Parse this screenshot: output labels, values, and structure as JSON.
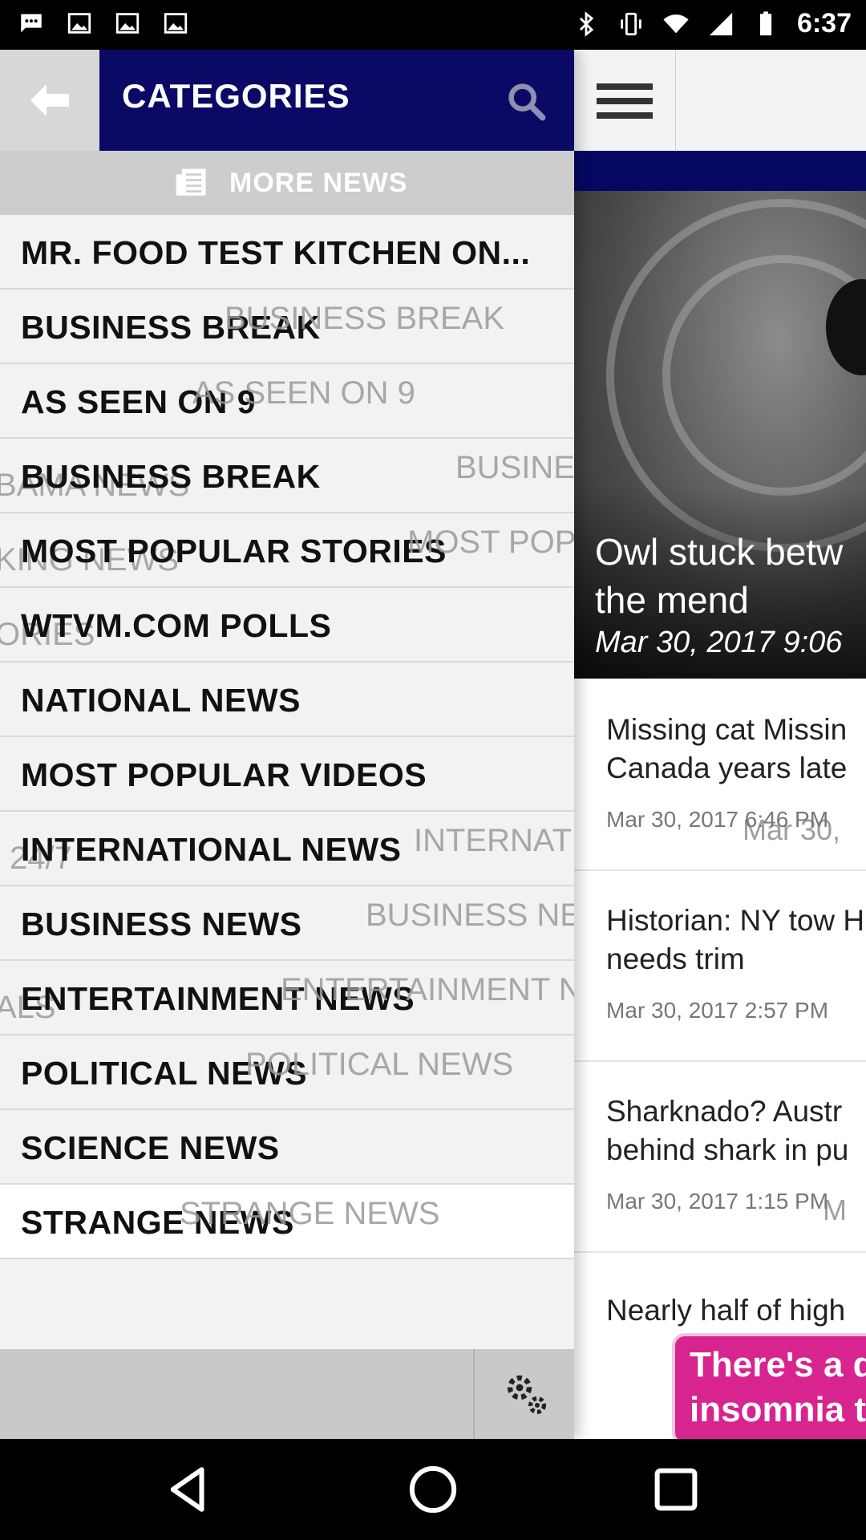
{
  "status_bar": {
    "time": "6:37",
    "left_icons": [
      "message-icon",
      "image-icon",
      "image-icon",
      "image-icon"
    ],
    "right_icons": [
      "bluetooth-icon",
      "vibrate-icon",
      "wifi-icon",
      "signal-icon",
      "battery-icon"
    ]
  },
  "drawer": {
    "header_title": "CATEGORIES",
    "more_news_label": "MORE NEWS",
    "categories": [
      {
        "label": "MR. FOOD TEST KITCHEN ON..."
      },
      {
        "label": "BUSINESS BREAK"
      },
      {
        "label": "AS SEEN ON 9"
      },
      {
        "label": "BUSINESS BREAK"
      },
      {
        "label": "MOST POPULAR STORIES"
      },
      {
        "label": "WTVM.COM POLLS"
      },
      {
        "label": "NATIONAL NEWS"
      },
      {
        "label": "MOST POPULAR VIDEOS"
      },
      {
        "label": "INTERNATIONAL NEWS"
      },
      {
        "label": "BUSINESS NEWS"
      },
      {
        "label": "ENTERTAINMENT NEWS"
      },
      {
        "label": "POLITICAL NEWS"
      },
      {
        "label": "SCIENCE NEWS"
      },
      {
        "label": "STRANGE NEWS"
      }
    ],
    "ghost_texts": {
      "g1": "BUSINESS BREAK",
      "g2": "AS SEEN ON 9",
      "g3": "BAMA NEWS",
      "g4": "BUSINESS BREAK",
      "g5": "KING NEWS",
      "g6": "MOST POPULAR STORIES",
      "g7": "ORIES",
      "g8": "24/7",
      "g9": "INTERNATIONAL NEWS",
      "g10": "BUSINESS NEWS",
      "g11": "ALS",
      "g12": "ENTERTAINMENT NEWS",
      "g13": "POLITICAL NEWS",
      "g14": "STRANGE NEWS"
    }
  },
  "news": {
    "hero": {
      "title_line1": "Owl stuck betw",
      "title_line2": "the mend",
      "date": "Mar 30, 2017 9:06",
      "date_ghost": "Ma"
    },
    "stories": [
      {
        "title_line1": "Missing cat Missin",
        "title_line2": "Canada years late",
        "date": "Mar 30, 2017 6:46 PM",
        "date_ghost": "Mar 30,"
      },
      {
        "title_line1": "Historian: NY tow Historia",
        "title_line2": "needs trim",
        "date": "Mar 30, 2017 2:57 PM",
        "date_ghost": ""
      },
      {
        "title_line1": "Sharknado? Austr",
        "title_line2": "behind shark in pu",
        "date": "Mar 30, 2017 1:15 PM",
        "date_ghost": "M"
      },
      {
        "title_line1": "Nearly half of high",
        "title_line2": "",
        "date": "",
        "date_ghost": ""
      }
    ],
    "ad": {
      "line1": "There's a d",
      "line2": "insomnia tr"
    }
  }
}
